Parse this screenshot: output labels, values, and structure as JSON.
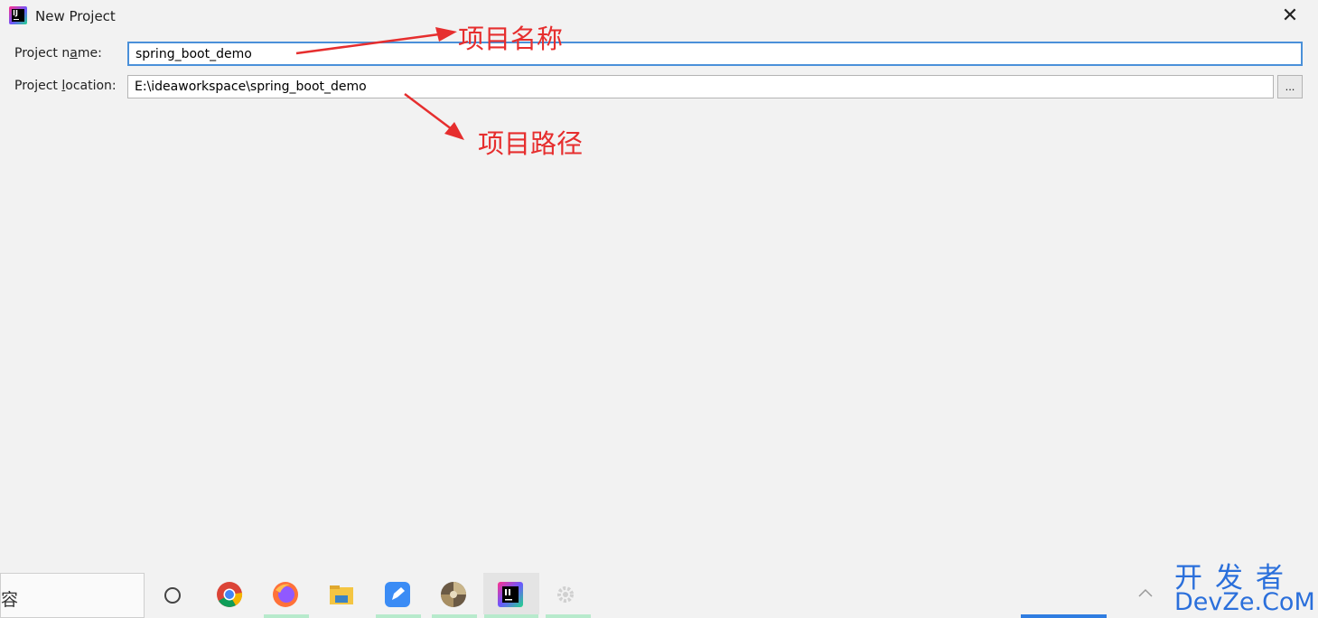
{
  "window": {
    "title": "New Project",
    "close_glyph": "✕",
    "app_icon": "intellij-idea-icon"
  },
  "form": {
    "project_name_label_pre": "Project n",
    "project_name_label_mn": "a",
    "project_name_label_post": "me:",
    "project_name_value": "spring_boot_demo",
    "project_location_label_pre": "Project ",
    "project_location_label_mn": "l",
    "project_location_label_post": "ocation:",
    "project_location_value": "E:\\ideaworkspace\\spring_boot_demo",
    "browse_label": "..."
  },
  "annotations": {
    "name_note": "项目名称",
    "location_note": "项目路径",
    "color": "#e62e2e"
  },
  "taskbar": {
    "search_text": "容",
    "icons": [
      "cortana-circle-icon",
      "chrome-icon",
      "firefox-icon",
      "file-explorer-icon",
      "feishu-icon",
      "photo-app-icon",
      "intellij-idea-icon",
      "settings-gear-icon"
    ]
  },
  "watermark": {
    "top": "开发者",
    "bottom": "DevZe.CoM",
    "color": "#2a6fdb"
  }
}
